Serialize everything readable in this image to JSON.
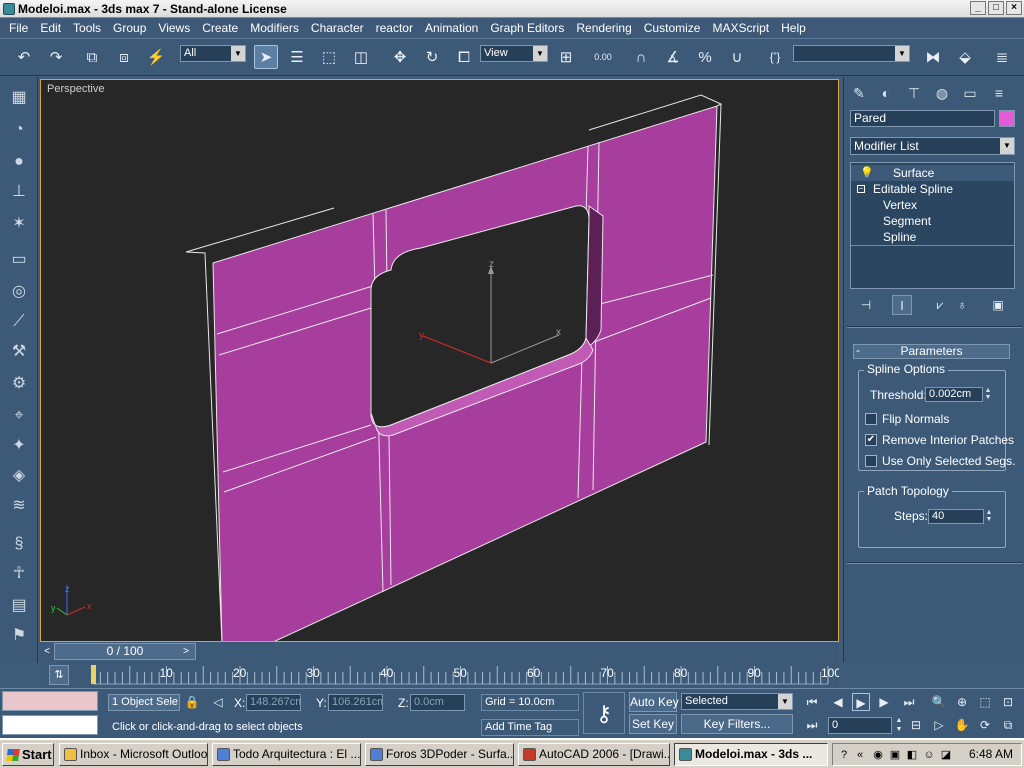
{
  "window": {
    "title": "Modeloi.max - 3ds max 7  - Stand-alone License",
    "controls": [
      "_",
      "□",
      "×"
    ]
  },
  "menubar": [
    "File",
    "Edit",
    "Tools",
    "Group",
    "Views",
    "Create",
    "Modifiers",
    "Character",
    "reactor",
    "Animation",
    "Graph Editors",
    "Rendering",
    "Customize",
    "MAXScript",
    "Help"
  ],
  "toolbar": {
    "selection_filter": "All",
    "ref_coord": "View",
    "named_selection": "",
    "angle_snap_label": "0.00"
  },
  "viewport": {
    "label": "Perspective",
    "axis_labels": {
      "z": "z",
      "y": "y",
      "x": "x"
    },
    "object_color": "#a73d9c"
  },
  "command_panel": {
    "object_name": "Pared",
    "object_color": "#e35bd6",
    "modifier_list": "Modifier List",
    "stack": [
      {
        "label": "Surface",
        "level": 0,
        "selected": true
      },
      {
        "label": "Editable Spline",
        "level": 0,
        "selected": false
      },
      {
        "label": "Vertex",
        "level": 1,
        "selected": false
      },
      {
        "label": "Segment",
        "level": 1,
        "selected": false
      },
      {
        "label": "Spline",
        "level": 1,
        "selected": false
      }
    ],
    "rollout": {
      "collapse": "-",
      "title": "Parameters",
      "spline_options_label": "Spline Options",
      "threshold_label": "Threshold:",
      "threshold_value": "0.002cm",
      "flip_normals_label": "Flip Normals",
      "flip_normals_checked": false,
      "remove_interior_label": "Remove Interior Patches",
      "remove_interior_checked": true,
      "use_only_selected_label": "Use Only Selected Segs.",
      "use_only_selected_checked": false,
      "patch_topology_label": "Patch Topology",
      "steps_label": "Steps:",
      "steps_value": "40"
    }
  },
  "timeslider": {
    "frame_display": "0 / 100",
    "left_arrow": "<",
    "right_arrow": ">"
  },
  "trackbar": {
    "tick_labels": [
      "10",
      "20",
      "30",
      "40",
      "50",
      "60",
      "70",
      "80",
      "90",
      "100"
    ],
    "tick_values": [
      10,
      20,
      30,
      40,
      50,
      60,
      70,
      80,
      90,
      100
    ]
  },
  "statusbar": {
    "selection_count": "1 Object Sele",
    "prompt": "Click or click-and-drag to select objects",
    "x_label": "X:",
    "x_value": "148.267cm",
    "y_label": "Y:",
    "y_value": "106.261cm",
    "z_label": "Z:",
    "z_value": "0.0cm",
    "grid": "Grid = 10.0cm",
    "add_time_tag": "Add Time Tag",
    "auto_key": "Auto Key",
    "set_key": "Set Key",
    "key_mode": "Selected",
    "key_filters": "Key Filters...",
    "current_frame": "0"
  },
  "taskbar": {
    "start": "Start",
    "tasks": [
      {
        "label": "Inbox - Microsoft Outlook",
        "active": false
      },
      {
        "label": "Todo Arquitectura : El ...",
        "active": false
      },
      {
        "label": "Foros 3DPoder - Surfa...",
        "active": false
      },
      {
        "label": "AutoCAD 2006 - [Drawi...",
        "active": false
      },
      {
        "label": "Modeloi.max - 3ds ...",
        "active": true
      }
    ],
    "clock": "6:48 AM"
  }
}
